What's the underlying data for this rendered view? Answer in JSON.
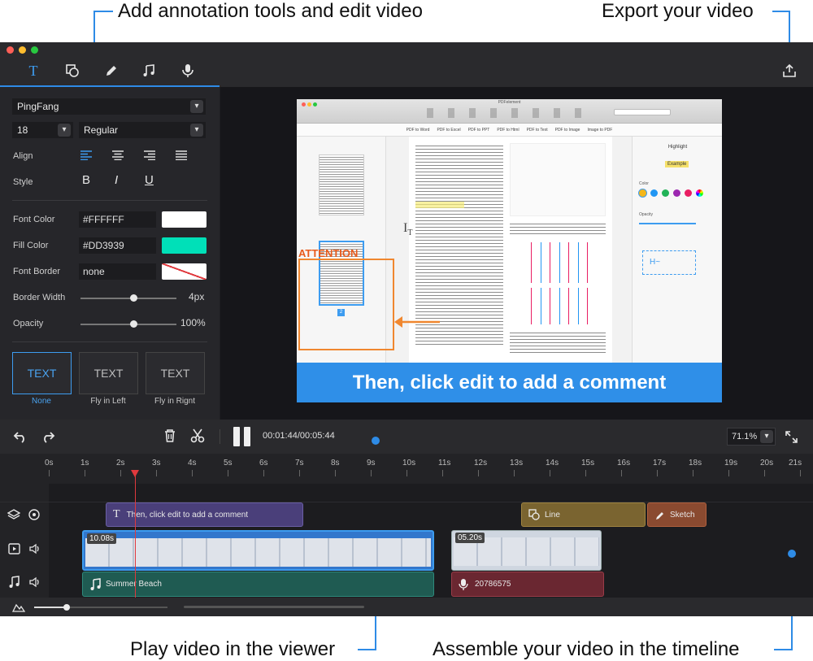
{
  "callouts": {
    "top_left": "Add annotation tools and edit video",
    "top_right": "Export your video",
    "bottom_left": "Play video in the viewer",
    "bottom_right": "Assemble your video in the timeline"
  },
  "tabs": [
    {
      "icon": "text-tool-icon",
      "active": true
    },
    {
      "icon": "shape-tool-icon"
    },
    {
      "icon": "pencil-icon"
    },
    {
      "icon": "music-icon"
    },
    {
      "icon": "microphone-icon"
    }
  ],
  "text_panel": {
    "font_family": "PingFang",
    "font_size": "18",
    "font_weight": "Regular",
    "align_label": "Align",
    "style_label": "Style",
    "style_bold": "B",
    "style_italic": "I",
    "style_underline": "U",
    "font_color_label": "Font Color",
    "font_color_value": "#FFFFFF",
    "fill_color_label": "Fill Color",
    "fill_color_value": "#DD3939",
    "fill_swatch": "#00e0b8",
    "font_border_label": "Font Border",
    "font_border_value": "none",
    "border_width_label": "Border Width",
    "border_width_value": "4px",
    "border_width_fraction": 0.55,
    "opacity_label": "Opacity",
    "opacity_value": "100%",
    "opacity_fraction": 0.55,
    "animations": [
      {
        "text": "TEXT",
        "label": "None",
        "selected": true
      },
      {
        "text": "TEXT",
        "label": "Fly in Left"
      },
      {
        "text": "TEXT",
        "label": "Fly in Rignt"
      }
    ]
  },
  "viewer": {
    "window_title": "PDFelement",
    "attention_text": "ATTENTION",
    "banner_text": "Then, click edit to add a comment",
    "toolbar_items": [
      "PDF to Word",
      "PDF to Excel",
      "PDF to PPT",
      "PDF to Html",
      "PDF to Text",
      "PDF to Image",
      "Image to PDF"
    ],
    "sidebar_title": "Highlight",
    "sidebar_tag": "Example",
    "sidebar_color_label": "Color",
    "sidebar_opacity_label": "Opacity",
    "page_number": "2"
  },
  "controls": {
    "time": "00:01:44/00:05:44",
    "zoom": "71.1%"
  },
  "ruler_labels": [
    "0s",
    "1s",
    "2s",
    "3s",
    "4s",
    "5s",
    "6s",
    "7s",
    "8s",
    "9s",
    "10s",
    "11s",
    "12s",
    "13s",
    "14s",
    "15s",
    "16s",
    "17s",
    "18s",
    "19s",
    "20s",
    "21s"
  ],
  "playhead_seconds": 2.4,
  "timeline": {
    "text_clip": "Then, click edit to add a comment",
    "line_clip": "Line",
    "sketch_clip": "Sketch",
    "video_clip_1_duration": "10.08s",
    "video_clip_2_duration": "05.20s",
    "music_clip": "Summer Beach",
    "voice_clip": "20786575"
  },
  "colors": {
    "accent": "#2e8be6",
    "text_clip": "#4a3f7a",
    "line_clip": "#7a6430",
    "sketch_clip": "#8a4a30",
    "music_clip": "#1f5b52",
    "voice_clip": "#6a2731",
    "banner": "#2f8fe8"
  }
}
